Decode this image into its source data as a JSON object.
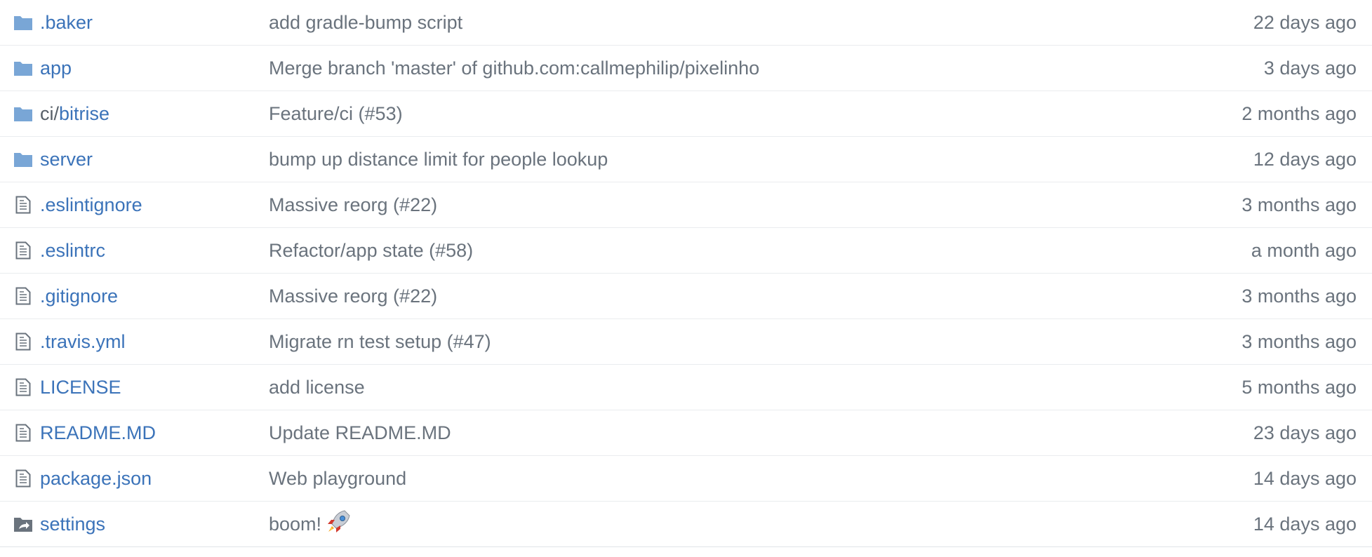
{
  "colors": {
    "link": "#3b73b9",
    "folder_icon": "#79a6d6",
    "muted_text": "#6a737d",
    "file_icon": "#6a737d",
    "divider": "#eaecef"
  },
  "files": [
    {
      "type": "folder",
      "icon": "folder-icon",
      "name": ".baker",
      "message": "add gradle-bump script",
      "age": "22 days ago"
    },
    {
      "type": "folder",
      "icon": "folder-icon",
      "name": "app",
      "message": "Merge branch 'master' of github.com:callmephilip/pixelinho",
      "age": "3 days ago"
    },
    {
      "type": "folder",
      "icon": "folder-icon",
      "name_prefix": "ci/",
      "name": "bitrise",
      "message": "Feature/ci (#53)",
      "age": "2 months ago"
    },
    {
      "type": "folder",
      "icon": "folder-icon",
      "name": "server",
      "message": "bump up distance limit for people lookup",
      "age": "12 days ago"
    },
    {
      "type": "file",
      "icon": "file-icon",
      "name": ".eslintignore",
      "message": "Massive reorg (#22)",
      "age": "3 months ago"
    },
    {
      "type": "file",
      "icon": "file-icon",
      "name": ".eslintrc",
      "message": "Refactor/app state (#58)",
      "age": "a month ago"
    },
    {
      "type": "file",
      "icon": "file-icon",
      "name": ".gitignore",
      "message": "Massive reorg (#22)",
      "age": "3 months ago"
    },
    {
      "type": "file",
      "icon": "file-icon",
      "name": ".travis.yml",
      "message": "Migrate rn test setup (#47)",
      "age": "3 months ago"
    },
    {
      "type": "file",
      "icon": "file-icon",
      "name": "LICENSE",
      "message": "add license",
      "age": "5 months ago"
    },
    {
      "type": "file",
      "icon": "file-icon",
      "name": "README.MD",
      "message": "Update README.MD",
      "age": "23 days ago"
    },
    {
      "type": "file",
      "icon": "file-icon",
      "name": "package.json",
      "message": "Web playground",
      "age": "14 days ago"
    },
    {
      "type": "symlink",
      "icon": "symlink-icon",
      "name": "settings",
      "message": "boom!",
      "message_emoji": "rocket-icon",
      "age": "14 days ago"
    }
  ]
}
